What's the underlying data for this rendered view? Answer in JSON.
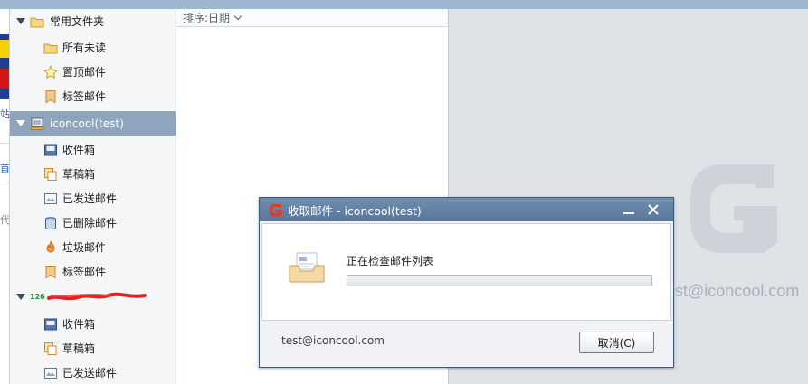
{
  "folders": {
    "common": {
      "label": "常用文件夹",
      "items": [
        {
          "label": "所有未读",
          "icon": "folder-icon"
        },
        {
          "label": "置顶邮件",
          "icon": "star-icon"
        },
        {
          "label": "标签邮件",
          "icon": "tag-icon"
        }
      ]
    },
    "account1": {
      "label": "iconcool(test)",
      "icon": "account-icon",
      "items": [
        {
          "label": "收件箱",
          "icon": "inbox-icon"
        },
        {
          "label": "草稿箱",
          "icon": "drafts-icon"
        },
        {
          "label": "已发送邮件",
          "icon": "sent-icon"
        },
        {
          "label": "已删除邮件",
          "icon": "trash-icon"
        },
        {
          "label": "垃圾邮件",
          "icon": "spam-icon"
        },
        {
          "label": "标签邮件",
          "icon": "tag-icon"
        }
      ]
    },
    "account2": {
      "label": "126",
      "items": [
        {
          "label": "收件箱",
          "icon": "inbox-icon"
        },
        {
          "label": "草稿箱",
          "icon": "drafts-icon"
        },
        {
          "label": "已发送邮件",
          "icon": "sent-icon"
        }
      ]
    }
  },
  "list": {
    "sort_label": "排序:日期"
  },
  "preview": {
    "account_watermark": "test@iconcool.com"
  },
  "dialog": {
    "title": "收取邮件 - iconcool(test)",
    "status": "正在检查邮件列表",
    "progress": 0,
    "account": "test@iconcool.com",
    "cancel_label": "取消(C)"
  },
  "colors": {
    "title_bar": "#58779a",
    "selected_row": "#8ea5bd",
    "brand_red": "#d23a2a"
  }
}
